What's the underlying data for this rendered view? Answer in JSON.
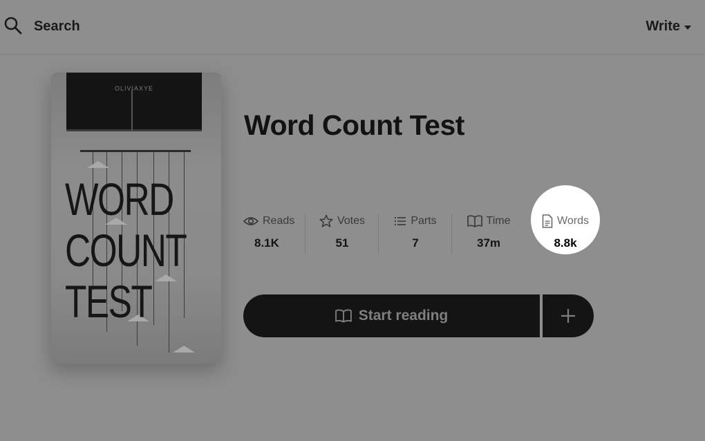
{
  "topbar": {
    "search_label": "Search",
    "write_label": "Write"
  },
  "cover": {
    "author": "OLIVIAXYE",
    "title_text": "WORD\nCOUNT\nTEST"
  },
  "book": {
    "title": "Word Count Test"
  },
  "stats": [
    {
      "icon": "eye-icon",
      "label": "Reads",
      "value": "8.1K"
    },
    {
      "icon": "star-icon",
      "label": "Votes",
      "value": "51"
    },
    {
      "icon": "list-icon",
      "label": "Parts",
      "value": "7"
    },
    {
      "icon": "book-icon",
      "label": "Time",
      "value": "37m"
    },
    {
      "icon": "document-icon",
      "label": "Words",
      "value": "8.8k",
      "highlighted": true
    }
  ],
  "actions": {
    "start_reading_label": "Start reading",
    "add_icon": "plus-icon"
  },
  "colors": {
    "overlay": "#8e8e8e",
    "button": "#141414",
    "highlight": "#ffffff"
  }
}
